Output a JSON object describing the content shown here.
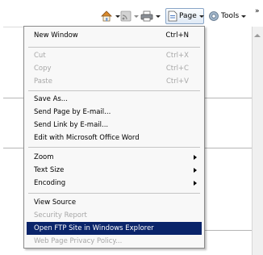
{
  "toolbar": {
    "page_label": "Page",
    "tools_label": "Tools",
    "overflow_label": "»"
  },
  "menu": {
    "items": [
      {
        "label": "New Window",
        "shortcut": "Ctrl+N",
        "disabled": false
      },
      {
        "label": "Cut",
        "shortcut": "Ctrl+X",
        "disabled": true
      },
      {
        "label": "Copy",
        "shortcut": "Ctrl+C",
        "disabled": true
      },
      {
        "label": "Paste",
        "shortcut": "Ctrl+V",
        "disabled": true
      },
      {
        "label": "Save As...",
        "disabled": false
      },
      {
        "label": "Send Page by E-mail...",
        "disabled": false
      },
      {
        "label": "Send Link by E-mail...",
        "disabled": false
      },
      {
        "label": "Edit with Microsoft Office Word",
        "disabled": false
      },
      {
        "label": "Zoom",
        "submenu": true
      },
      {
        "label": "Text Size",
        "submenu": true
      },
      {
        "label": "Encoding",
        "submenu": true
      },
      {
        "label": "View Source",
        "disabled": false
      },
      {
        "label": "Security Report",
        "disabled": true
      },
      {
        "label": "Open FTP Site in Windows Explorer",
        "disabled": false,
        "selected": true
      },
      {
        "label": "Web Page Privacy Policy...",
        "disabled": true
      }
    ]
  },
  "colors": {
    "highlight": "#0a246a",
    "disabled_text": "#a7a7a7",
    "menu_background": "#f8f8f8"
  }
}
